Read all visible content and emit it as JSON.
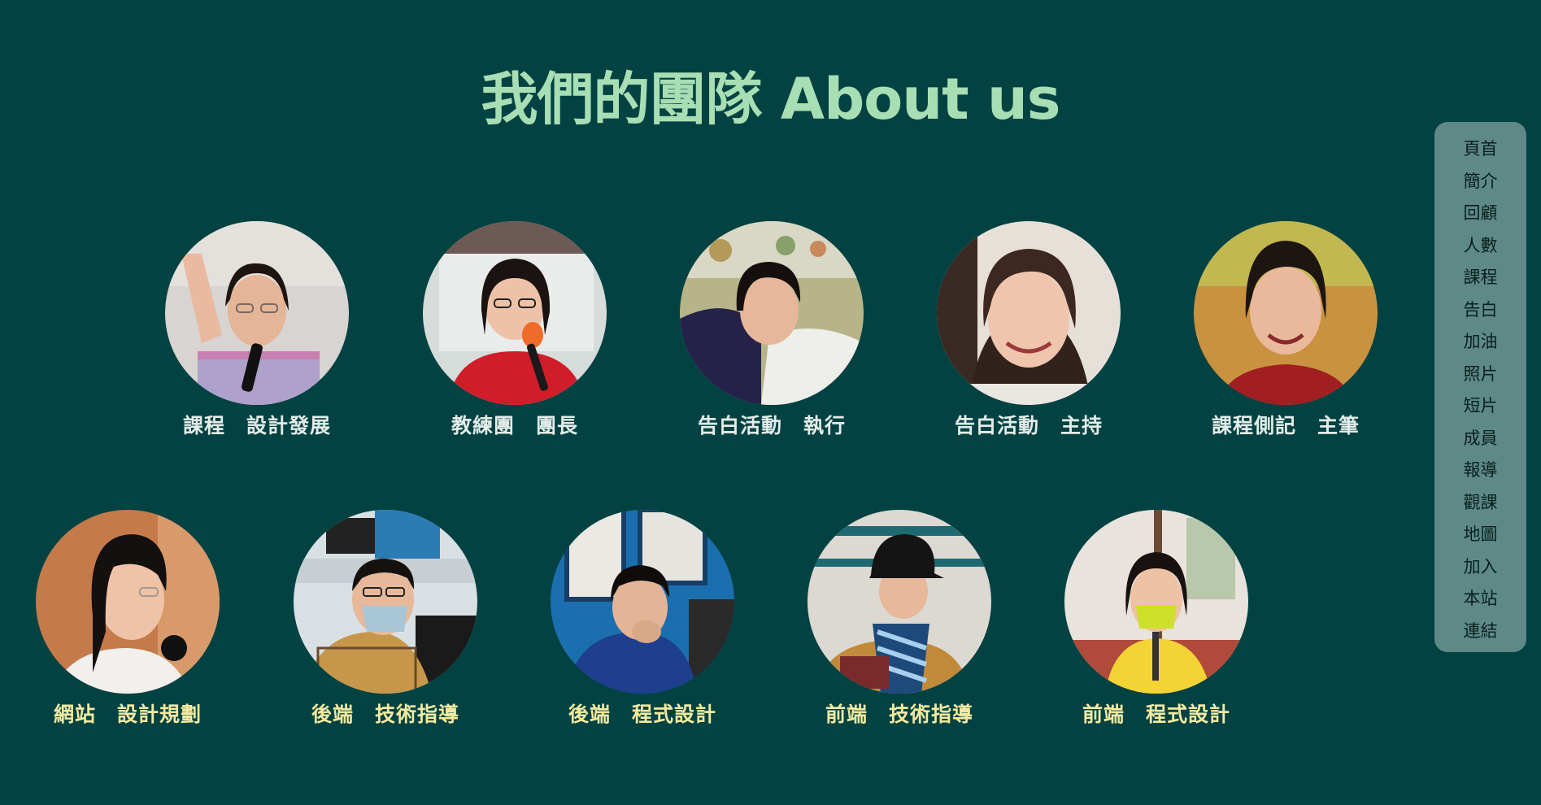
{
  "page": {
    "title": "我們的團隊 About us"
  },
  "team": {
    "row1": [
      {
        "role": "課程　設計發展",
        "icon": "member-photo-1"
      },
      {
        "role": "教練團　團長",
        "icon": "member-photo-2"
      },
      {
        "role": "告白活動　執行",
        "icon": "member-photo-3"
      },
      {
        "role": "告白活動　主持",
        "icon": "member-photo-4"
      },
      {
        "role": "課程側記　主筆",
        "icon": "member-photo-5"
      }
    ],
    "row2": [
      {
        "role": "網站　設計規劃",
        "icon": "member-photo-6"
      },
      {
        "role": "後端　技術指導",
        "icon": "member-photo-7"
      },
      {
        "role": "後端　程式設計",
        "icon": "member-photo-8"
      },
      {
        "role": "前端　技術指導",
        "icon": "member-photo-9"
      },
      {
        "role": "前端　程式設計",
        "icon": "member-photo-10"
      }
    ]
  },
  "nav": {
    "items": [
      "頁首",
      "簡介",
      "回顧",
      "人數",
      "課程",
      "告白",
      "加油",
      "照片",
      "短片",
      "成員",
      "報導",
      "觀課",
      "地圖",
      "加入",
      "本站",
      "連結"
    ]
  },
  "colors": {
    "background": "#024242",
    "title": "#a8deb4",
    "row1_label": "#e3ece8",
    "row2_label": "#f3eaa0",
    "nav_background": "#5e8986",
    "nav_text": "#07201e"
  }
}
